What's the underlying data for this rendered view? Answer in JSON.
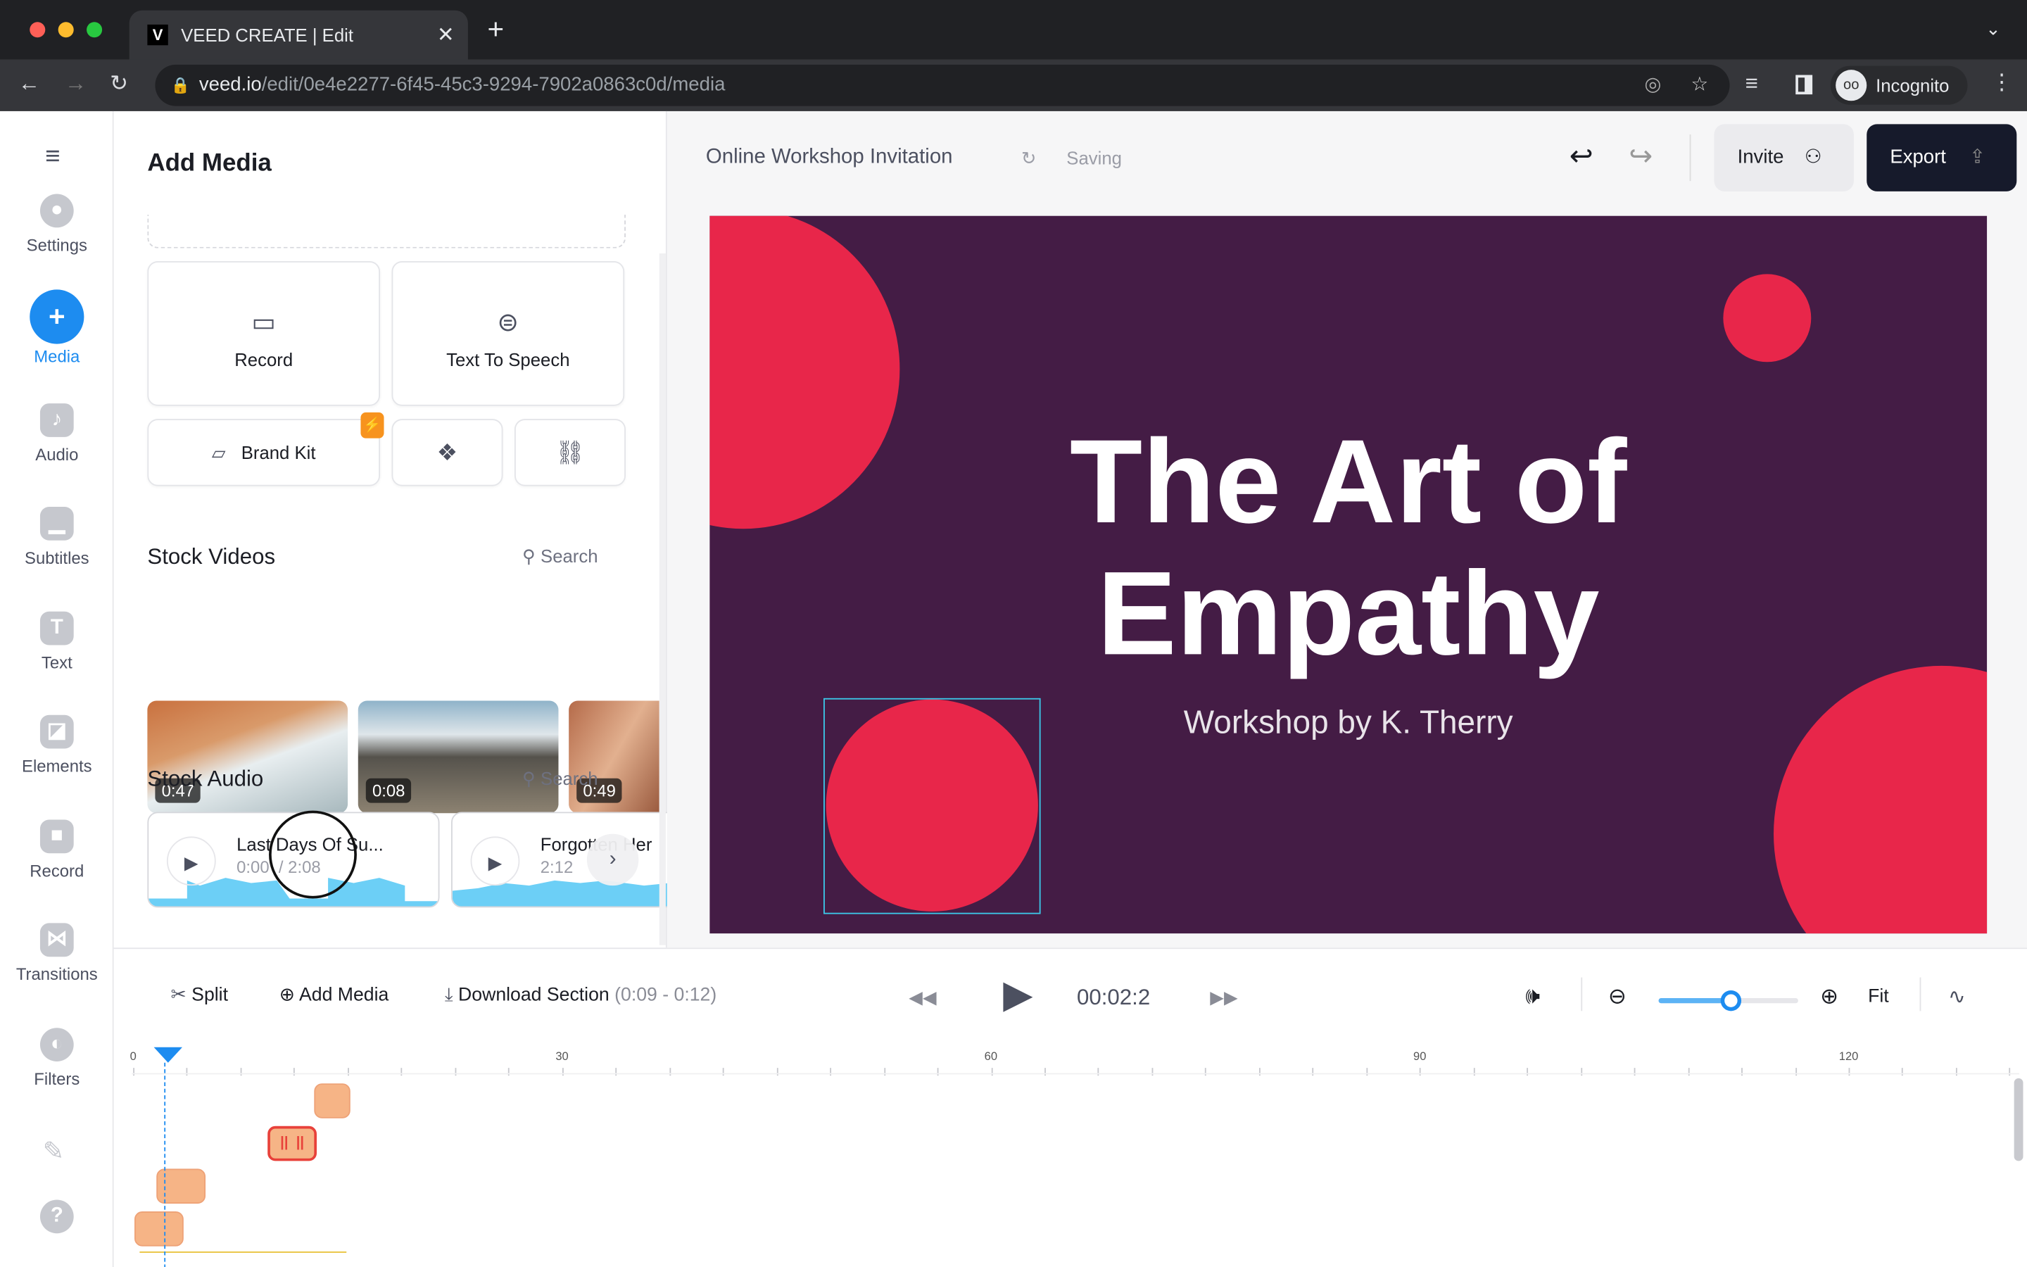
{
  "browser": {
    "tab_title": "VEED CREATE | Edit",
    "tab_favicon": "V",
    "url_domain": "veed.io",
    "url_path": "/edit/0e4e2277-6f45-45c3-9294-7902a0863c0d/media",
    "profile": "Incognito"
  },
  "nav": {
    "items": [
      {
        "label": "Settings",
        "icon": "gear-icon"
      },
      {
        "label": "Media",
        "icon": "plus-icon",
        "active": true
      },
      {
        "label": "Audio",
        "icon": "music-note-icon"
      },
      {
        "label": "Subtitles",
        "icon": "subtitles-icon"
      },
      {
        "label": "Text",
        "icon": "text-icon"
      },
      {
        "label": "Elements",
        "icon": "elements-icon"
      },
      {
        "label": "Record",
        "icon": "camera-icon"
      },
      {
        "label": "Transitions",
        "icon": "transitions-icon"
      },
      {
        "label": "Filters",
        "icon": "filters-icon"
      }
    ]
  },
  "panel": {
    "title": "Add Media",
    "record": "Record",
    "tts": "Text To Speech",
    "brand_kit": "Brand Kit",
    "stock_videos": {
      "title": "Stock Videos",
      "search": "Search",
      "items": [
        {
          "duration": "0:47"
        },
        {
          "duration": "0:08"
        },
        {
          "duration": "0:49"
        }
      ]
    },
    "stock_audio": {
      "title": "Stock Audio",
      "search": "Search",
      "items": [
        {
          "title": "Last Days Of Su...",
          "time": "0:00",
          "total": "/ 2:08"
        },
        {
          "title": "Forgotten Her",
          "time": "2:12"
        }
      ]
    }
  },
  "header": {
    "project": "Online Workshop Invitation",
    "status": "Saving",
    "invite": "Invite",
    "export": "Export"
  },
  "canvas": {
    "title_line1": "The Art of",
    "title_line2": "Empathy",
    "subtitle": "Workshop by K. Therry",
    "bg": "#441c45",
    "accent": "#e8264a"
  },
  "timeline": {
    "split": "Split",
    "add_media": "Add Media",
    "download": "Download Section",
    "range": "(0:09 - 0:12)",
    "time": "00:02:2",
    "fit": "Fit",
    "zoom_level": 0.52,
    "ruler": [
      "0",
      "30",
      "60",
      "90",
      "120"
    ]
  }
}
